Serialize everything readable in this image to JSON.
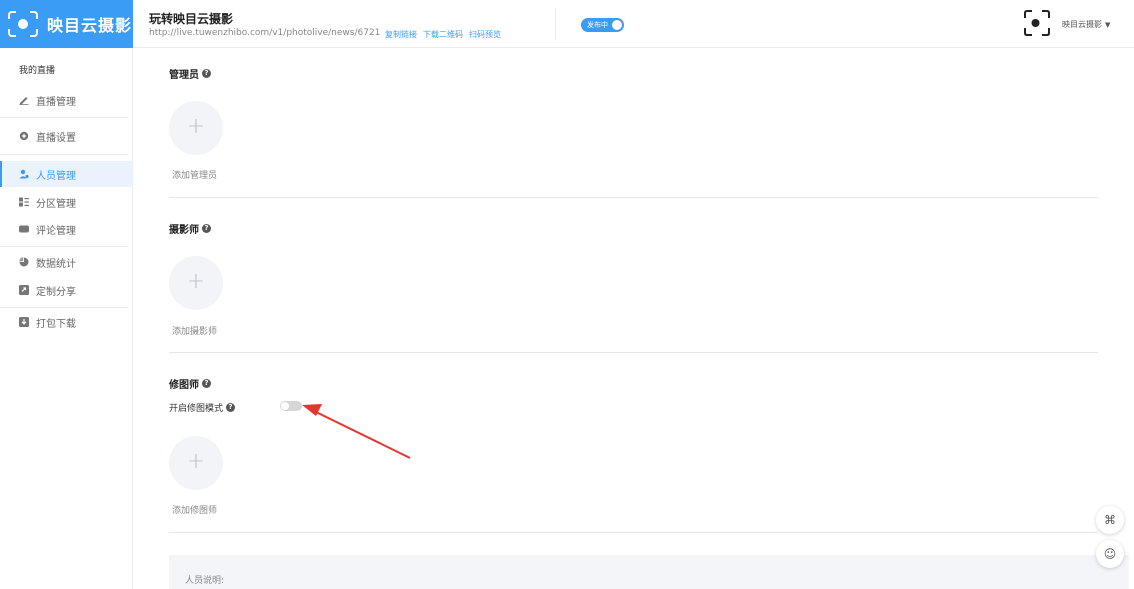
{
  "brand": {
    "name": "映目云摄影"
  },
  "sidebar": {
    "title": "我的直播",
    "items": [
      {
        "label": "直播管理",
        "icon": "pencil-icon"
      },
      {
        "label": "直播设置",
        "icon": "gear-icon"
      },
      {
        "label": "人员管理",
        "icon": "users-icon"
      },
      {
        "label": "分区管理",
        "icon": "partition-icon"
      },
      {
        "label": "评论管理",
        "icon": "comment-icon"
      },
      {
        "label": "数据统计",
        "icon": "pie-chart-icon"
      },
      {
        "label": "定制分享",
        "icon": "share-icon"
      },
      {
        "label": "打包下载",
        "icon": "download-icon"
      }
    ]
  },
  "header": {
    "title": "玩转映目云摄影",
    "url": "http://live.tuwenzhibo.com/v1/photolive/news/6721",
    "links": {
      "copy": "复制链接",
      "qrcode": "下载二维码",
      "preview": "扫码预览"
    },
    "publish_label": "发布中",
    "user_name": "映目云摄影",
    "caret": "▼"
  },
  "sections": {
    "admin": {
      "title": "管理员",
      "add_label": "添加管理员",
      "plus": "+"
    },
    "photographer": {
      "title": "摄影师",
      "add_label": "添加摄影师",
      "plus": "+"
    },
    "retoucher": {
      "title": "修图师",
      "mode_label": "开启修图模式",
      "add_label": "添加修图师",
      "plus": "+"
    }
  },
  "notes": {
    "label": "人员说明:"
  },
  "help_mark": "?",
  "float": {
    "apps": "⌘",
    "service": "☺"
  },
  "colors": {
    "accent": "#3a9cf4",
    "arrow": "#e8332f"
  }
}
